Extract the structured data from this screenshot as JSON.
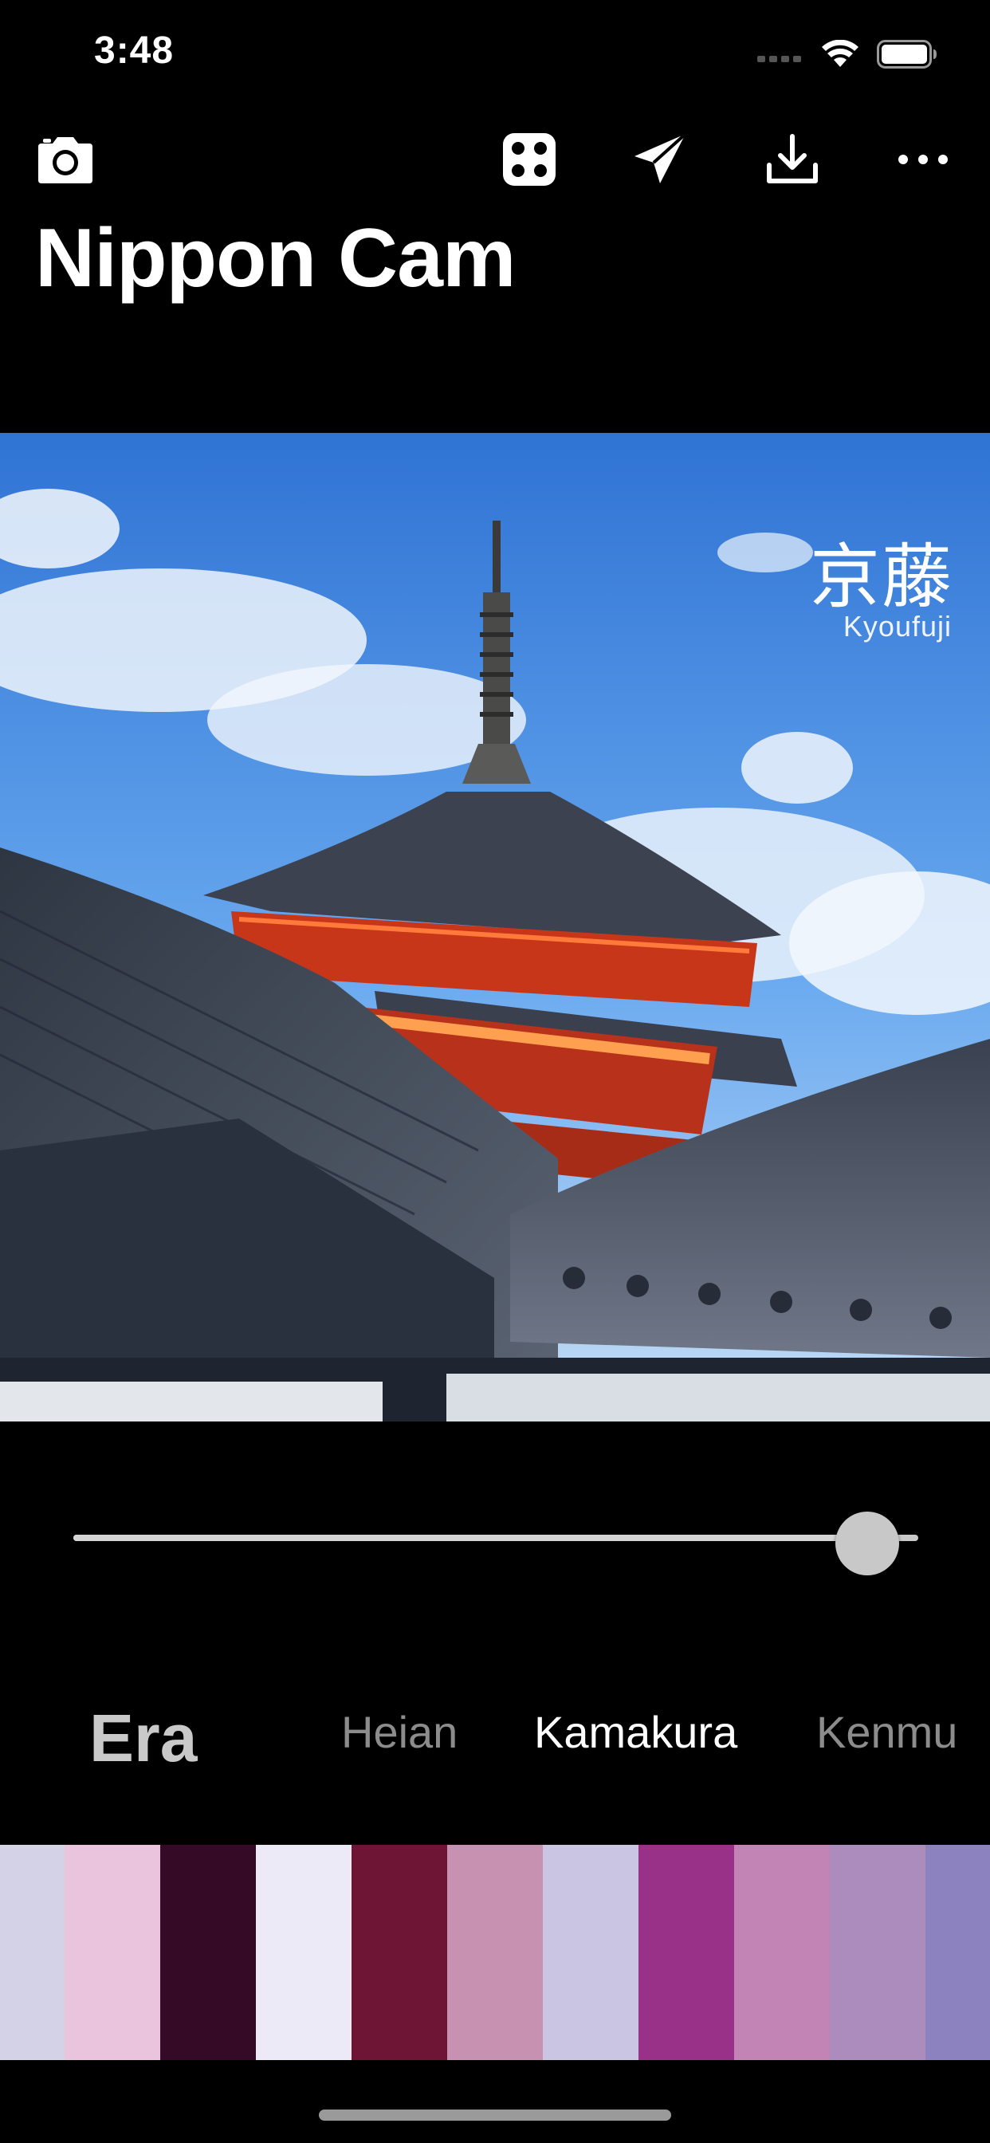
{
  "status_bar": {
    "time": "3:48"
  },
  "toolbar": {
    "icons": [
      "camera-icon",
      "dice-icon",
      "send-icon",
      "download-icon",
      "more-icon"
    ]
  },
  "app": {
    "title": "Nippon Cam"
  },
  "photo": {
    "color_name_kanji": "京藤",
    "color_name_romaji": "Kyoufuji"
  },
  "slider": {
    "value_fraction": 0.94
  },
  "era": {
    "label": "Era",
    "tabs": [
      {
        "label": "Heian",
        "active": false
      },
      {
        "label": "Kamakura",
        "active": true
      },
      {
        "label": "Kenmu",
        "active": false
      }
    ]
  },
  "palette": {
    "swatches": [
      "#d3d2e6",
      "#e9c4dc",
      "#340a26",
      "#ebeaf6",
      "#6e1535",
      "#c791b2",
      "#c9c5e2",
      "#9a3189",
      "#c283b5",
      "#ac8cbd",
      "#8c82c0"
    ]
  },
  "colors": {
    "background": "#000000",
    "tab_active": "#ffffff",
    "tab_inactive": "#8c8c8c"
  }
}
